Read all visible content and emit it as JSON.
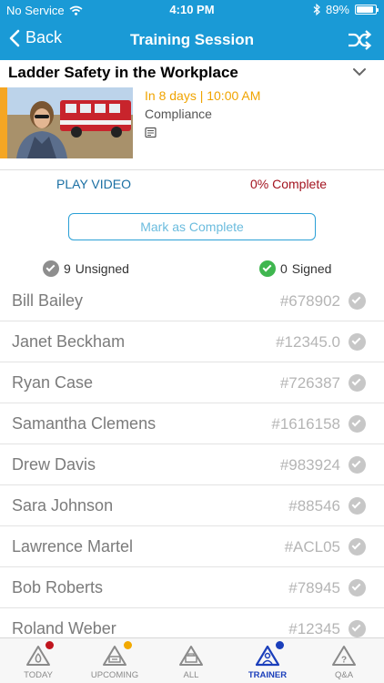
{
  "status_bar": {
    "carrier": "No Service",
    "time": "4:10 PM",
    "battery": "89%",
    "battery_level": 0.89
  },
  "nav": {
    "back_label": "Back",
    "title": "Training Session"
  },
  "session": {
    "title": "Ladder Safety in the Workplace",
    "due": "In 8 days | 10:00 AM",
    "category": "Compliance",
    "accent_color": "#f5a623"
  },
  "actions": {
    "play_video": "PLAY VIDEO",
    "percent_complete": "0% Complete",
    "mark_complete": "Mark as Complete"
  },
  "counts": {
    "unsigned_count": "9",
    "unsigned_label": "Unsigned",
    "signed_count": "0",
    "signed_label": "Signed"
  },
  "trainees": [
    {
      "name": "Bill Bailey",
      "id": "#678902"
    },
    {
      "name": "Janet Beckham",
      "id": "#12345.0"
    },
    {
      "name": "Ryan Case",
      "id": "#726387"
    },
    {
      "name": "Samantha Clemens",
      "id": "#1616158"
    },
    {
      "name": "Drew Davis",
      "id": "#983924"
    },
    {
      "name": "Sara Johnson",
      "id": "#88546"
    },
    {
      "name": "Lawrence Martel",
      "id": "#ACL05"
    },
    {
      "name": "Bob Roberts",
      "id": "#78945"
    },
    {
      "name": "Roland Weber",
      "id": "#12345"
    }
  ],
  "tabs": [
    {
      "label": "TODAY",
      "icon": "today-icon",
      "badge_color": "#c0151e"
    },
    {
      "label": "UPCOMING",
      "icon": "upcoming-icon",
      "badge_color": "#f2a900"
    },
    {
      "label": "ALL",
      "icon": "all-icon",
      "badge_color": ""
    },
    {
      "label": "TRAINER",
      "icon": "trainer-icon",
      "badge_color": "#1b3fbb"
    },
    {
      "label": "Q&A",
      "icon": "qa-icon",
      "badge_color": ""
    }
  ],
  "colors": {
    "header": "#1a9ad6",
    "due_text": "#f0a400",
    "percent_text": "#a31420",
    "active_tab": "#1b3fbb"
  }
}
